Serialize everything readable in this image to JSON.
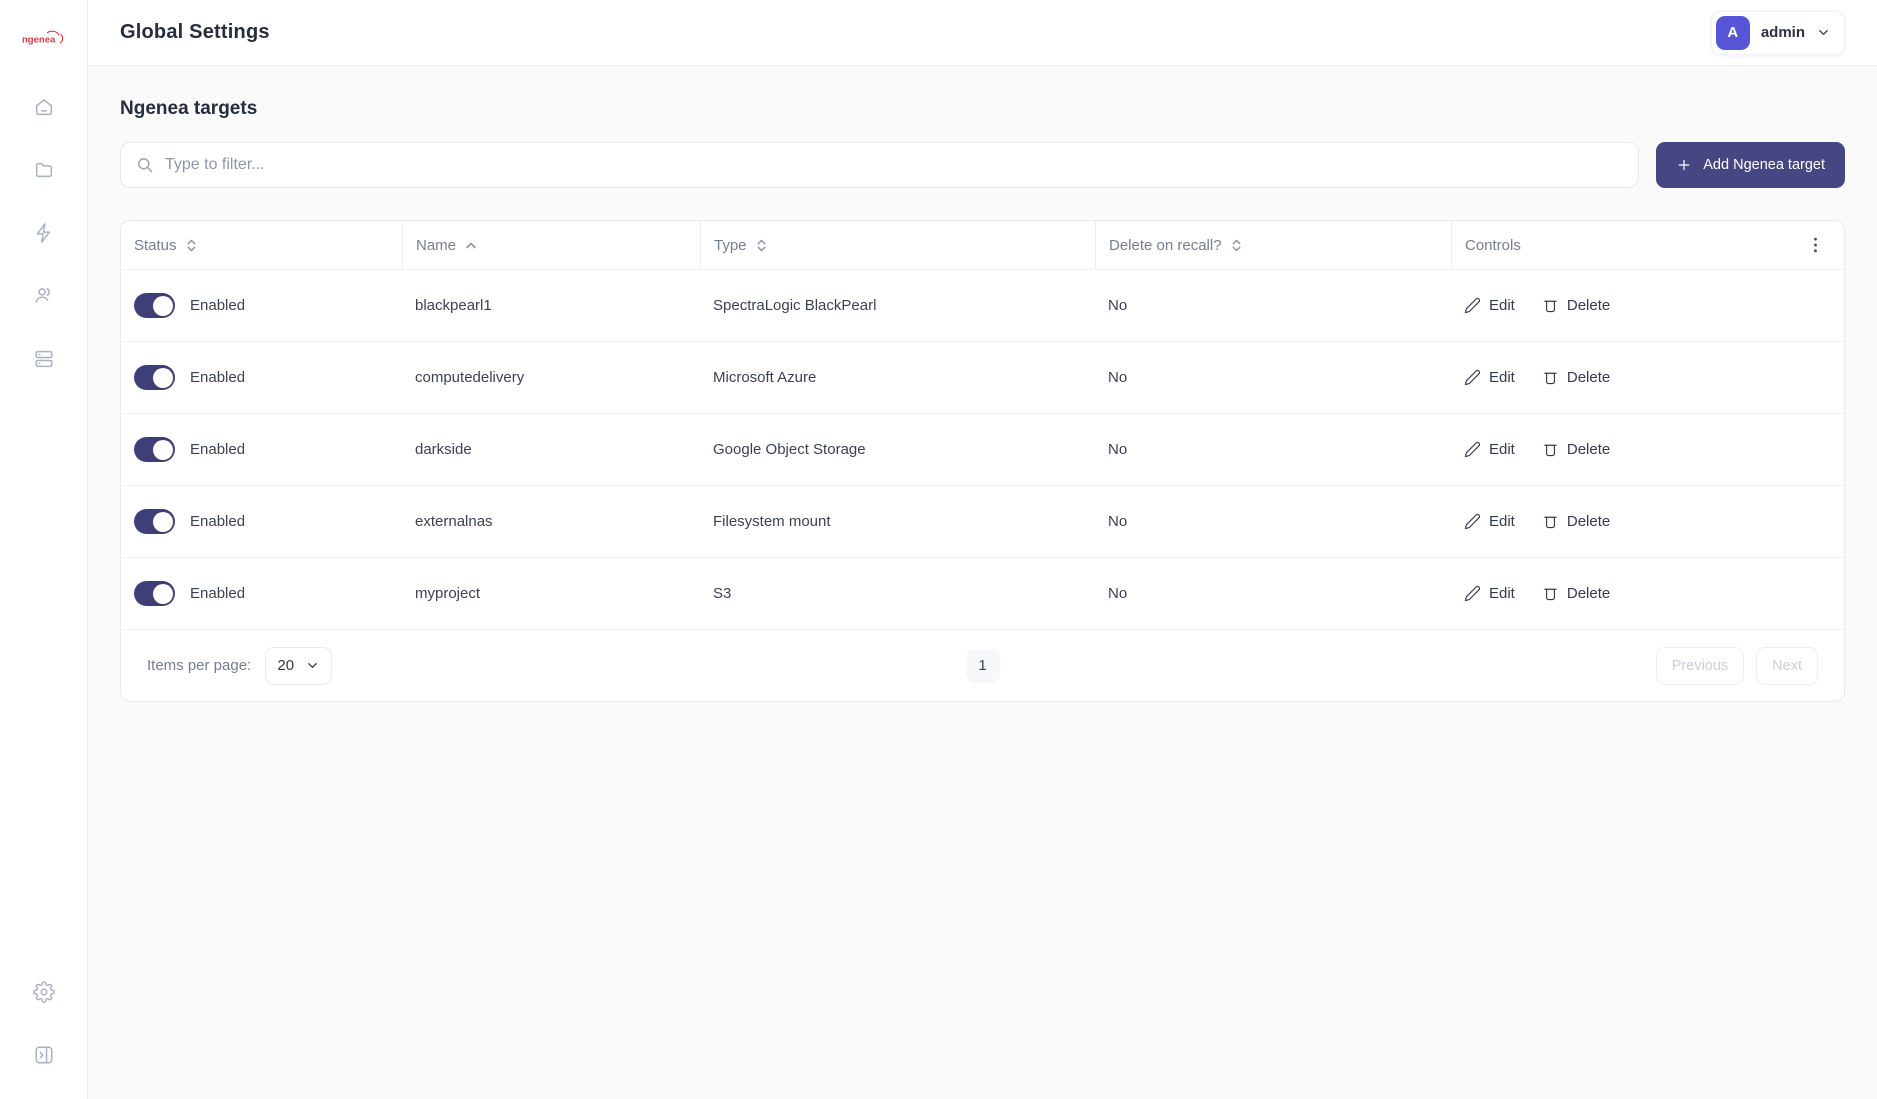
{
  "brand": {
    "logo_text": "ngenea",
    "logo_color": "#E0353F"
  },
  "header": {
    "title": "Global Settings",
    "user": {
      "initial": "A",
      "name": "admin"
    }
  },
  "sidebar": {
    "nav_items": [
      {
        "icon": "home-icon"
      },
      {
        "icon": "folder-icon"
      },
      {
        "icon": "lightning-icon"
      },
      {
        "icon": "users-icon"
      },
      {
        "icon": "servers-icon"
      }
    ],
    "bottom_items": [
      {
        "icon": "settings-gear-icon"
      },
      {
        "icon": "collapse-panel-icon"
      }
    ]
  },
  "page": {
    "section_title": "Ngenea targets",
    "filter_placeholder": "Type to filter...",
    "add_button_label": "Add Ngenea target"
  },
  "table": {
    "columns": [
      {
        "label": "Status",
        "sort": "both"
      },
      {
        "label": "Name",
        "sort": "asc"
      },
      {
        "label": "Type",
        "sort": "both"
      },
      {
        "label": "Delete on recall?",
        "sort": "both"
      },
      {
        "label": "Controls",
        "sort": "none"
      }
    ],
    "actions": {
      "edit_label": "Edit",
      "delete_label": "Delete"
    },
    "rows": [
      {
        "status": "Enabled",
        "enabled": true,
        "name": "blackpearl1",
        "type": "SpectraLogic BlackPearl",
        "delete_on_recall": "No"
      },
      {
        "status": "Enabled",
        "enabled": true,
        "name": "computedelivery",
        "type": "Microsoft Azure",
        "delete_on_recall": "No"
      },
      {
        "status": "Enabled",
        "enabled": true,
        "name": "darkside",
        "type": "Google Object Storage",
        "delete_on_recall": "No"
      },
      {
        "status": "Enabled",
        "enabled": true,
        "name": "externalnas",
        "type": "Filesystem mount",
        "delete_on_recall": "No"
      },
      {
        "status": "Enabled",
        "enabled": true,
        "name": "myproject",
        "type": "S3",
        "delete_on_recall": "No"
      }
    ]
  },
  "pagination": {
    "items_per_page_label": "Items per page:",
    "items_per_page_value": "20",
    "current_page": "1",
    "previous_label": "Previous",
    "next_label": "Next"
  },
  "colors": {
    "accent_indigo": "#464683",
    "toggle_on": "#3E3F79",
    "avatar_indigo": "#5655D7",
    "logo_red": "#E0353F",
    "title_text": "#252E3F",
    "muted_text": "#75808F",
    "border": "#E9EAF0",
    "content_bg": "#FAFAFB"
  }
}
